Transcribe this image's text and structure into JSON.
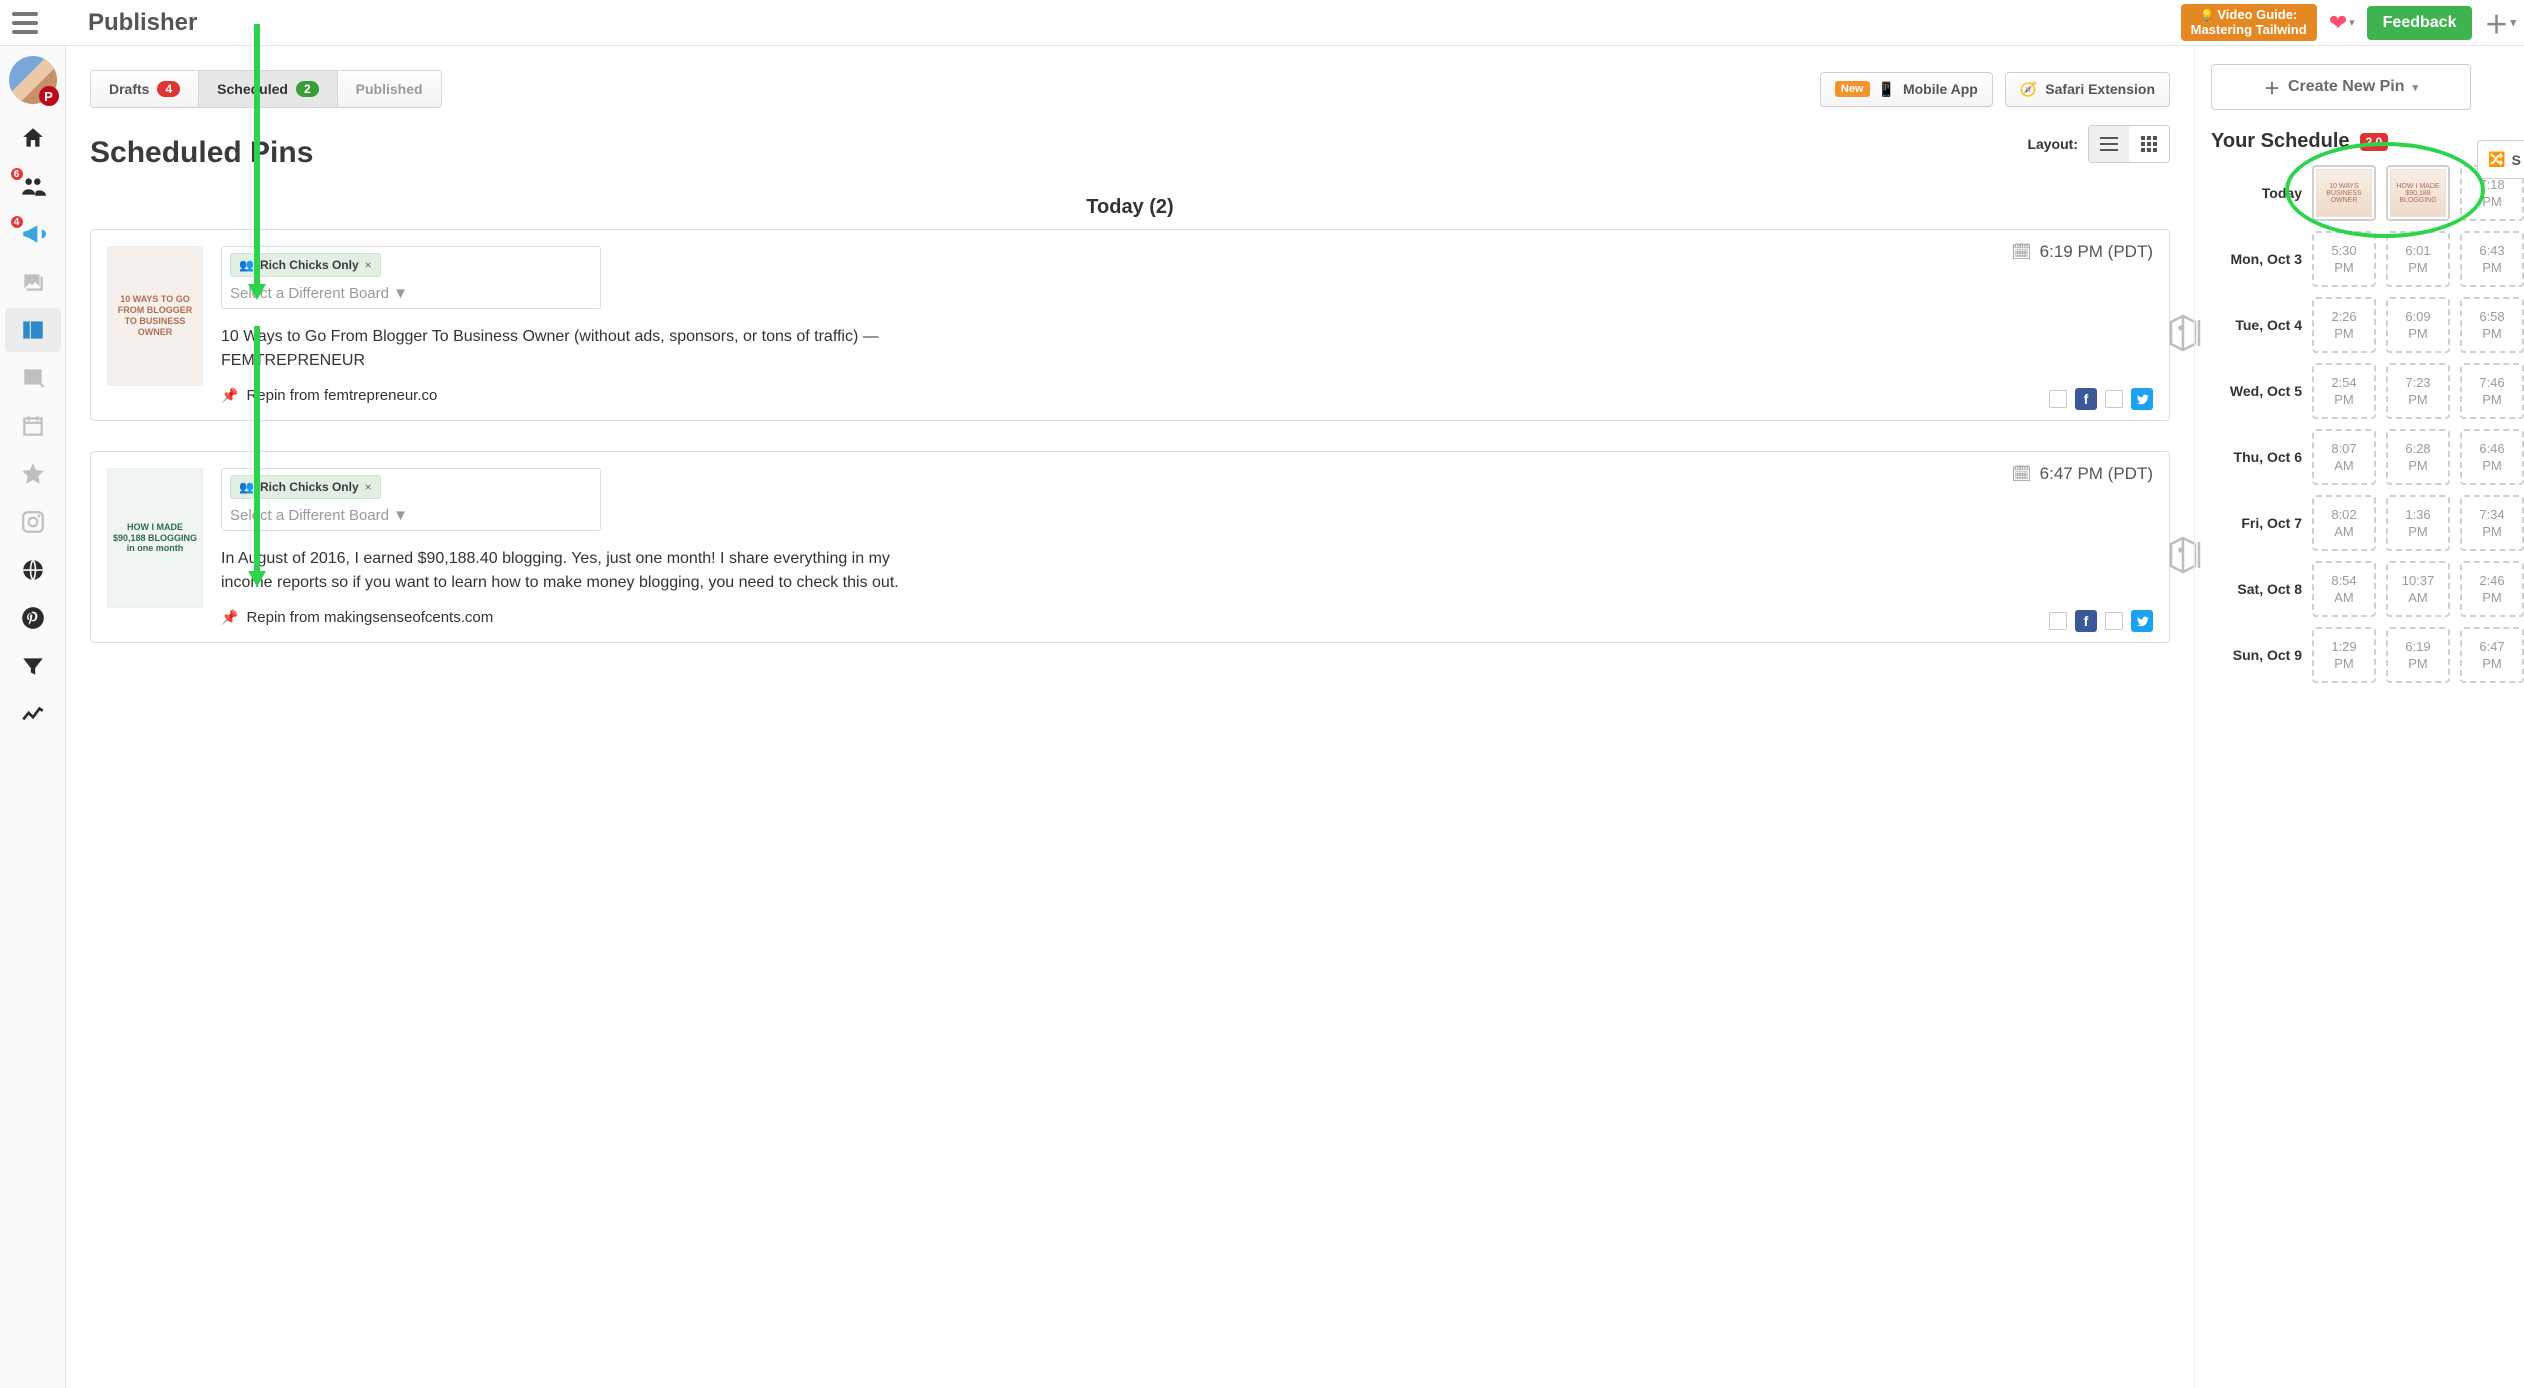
{
  "header": {
    "title": "Publisher",
    "video_guide_line1": "Video Guide:",
    "video_guide_line2": "Mastering Tailwind",
    "feedback": "Feedback"
  },
  "sidebar": {
    "avatar_network": "P",
    "badges": {
      "tribes": "6",
      "campaigns": "4"
    }
  },
  "tabs": {
    "drafts_label": "Drafts",
    "drafts_count": "4",
    "scheduled_label": "Scheduled",
    "scheduled_count": "2",
    "published_label": "Published",
    "mobile_new": "New",
    "mobile_label": "Mobile App",
    "safari_label": "Safari Extension"
  },
  "main": {
    "section_title": "Scheduled Pins",
    "layout_label": "Layout:",
    "group_header": "Today (2)"
  },
  "pins": [
    {
      "thumb_text": "10 WAYS TO GO FROM BLOGGER TO BUSINESS OWNER",
      "board_tag": "Rich Chicks Only",
      "board_placeholder": "Select a Different Board ▼",
      "time": "6:19 PM (PDT)",
      "description": "10 Ways to Go From Blogger To Business Owner (without ads, sponsors, or tons of traffic) — FEMTREPRENEUR",
      "repin": "Repin from femtrepreneur.co"
    },
    {
      "thumb_text": "HOW I MADE $90,188 BLOGGING in one month",
      "board_tag": "Rich Chicks Only",
      "board_placeholder": "Select a Different Board ▼",
      "time": "6:47 PM (PDT)",
      "description": "In August of 2016, I earned $90,188.40 blogging. Yes, just one month! I share everything in my income reports so if you want to learn how to make money blogging, you need to check this out.",
      "repin": "Repin from makingsenseofcents.com"
    }
  ],
  "right": {
    "create_pin": "Create New Pin",
    "shuffle": "S",
    "title": "Your Schedule",
    "version": "2.0",
    "rows": [
      {
        "day": "Today",
        "slots": [
          {
            "filled": true,
            "mini": "10 WAYS BUSINESS OWNER"
          },
          {
            "filled": true,
            "mini": "HOW I MADE $90,188 BLOGGING"
          },
          {
            "t1": "7:18",
            "t2": "PM"
          }
        ]
      },
      {
        "day": "Mon, Oct 3",
        "slots": [
          {
            "t1": "5:30",
            "t2": "PM"
          },
          {
            "t1": "6:01",
            "t2": "PM"
          },
          {
            "t1": "6:43",
            "t2": "PM"
          }
        ]
      },
      {
        "day": "Tue, Oct 4",
        "slots": [
          {
            "t1": "2:26",
            "t2": "PM"
          },
          {
            "t1": "6:09",
            "t2": "PM"
          },
          {
            "t1": "6:58",
            "t2": "PM"
          }
        ]
      },
      {
        "day": "Wed, Oct 5",
        "slots": [
          {
            "t1": "2:54",
            "t2": "PM"
          },
          {
            "t1": "7:23",
            "t2": "PM"
          },
          {
            "t1": "7:46",
            "t2": "PM"
          }
        ]
      },
      {
        "day": "Thu, Oct 6",
        "slots": [
          {
            "t1": "8:07",
            "t2": "AM"
          },
          {
            "t1": "6:28",
            "t2": "PM"
          },
          {
            "t1": "6:46",
            "t2": "PM"
          }
        ]
      },
      {
        "day": "Fri, Oct 7",
        "slots": [
          {
            "t1": "8:02",
            "t2": "AM"
          },
          {
            "t1": "1:36",
            "t2": "PM"
          },
          {
            "t1": "7:34",
            "t2": "PM"
          }
        ]
      },
      {
        "day": "Sat, Oct 8",
        "slots": [
          {
            "t1": "8:54",
            "t2": "AM"
          },
          {
            "t1": "10:37",
            "t2": "AM"
          },
          {
            "t1": "2:46",
            "t2": "PM"
          }
        ]
      },
      {
        "day": "Sun, Oct 9",
        "slots": [
          {
            "t1": "1:29",
            "t2": "PM"
          },
          {
            "t1": "6:19",
            "t2": "PM"
          },
          {
            "t1": "6:47",
            "t2": "PM"
          }
        ]
      }
    ]
  }
}
